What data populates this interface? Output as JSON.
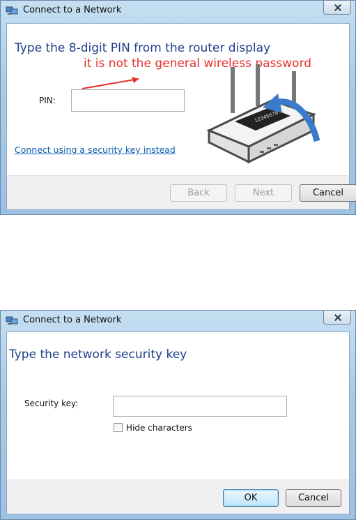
{
  "dialog1": {
    "title": "Connect to a Network",
    "heading": "Type the 8-digit PIN from the router display",
    "annotation": "it is not the general wireless password",
    "pin_label": "PIN:",
    "pin_value": "",
    "alt_link": "Connect using a security key instead",
    "router_display_text": "12345678",
    "buttons": {
      "back": "Back",
      "next": "Next",
      "cancel": "Cancel"
    }
  },
  "dialog2": {
    "title": "Connect to a Network",
    "heading": "Type the network security key",
    "key_label": "Security key:",
    "key_value": "",
    "hide_label": "Hide characters",
    "hide_checked": false,
    "buttons": {
      "ok": "OK",
      "cancel": "Cancel"
    }
  },
  "colors": {
    "heading": "#1e3f8a",
    "link": "#0b5fb3",
    "annotation": "#e6302a",
    "arrow": "#3a7cc9"
  }
}
